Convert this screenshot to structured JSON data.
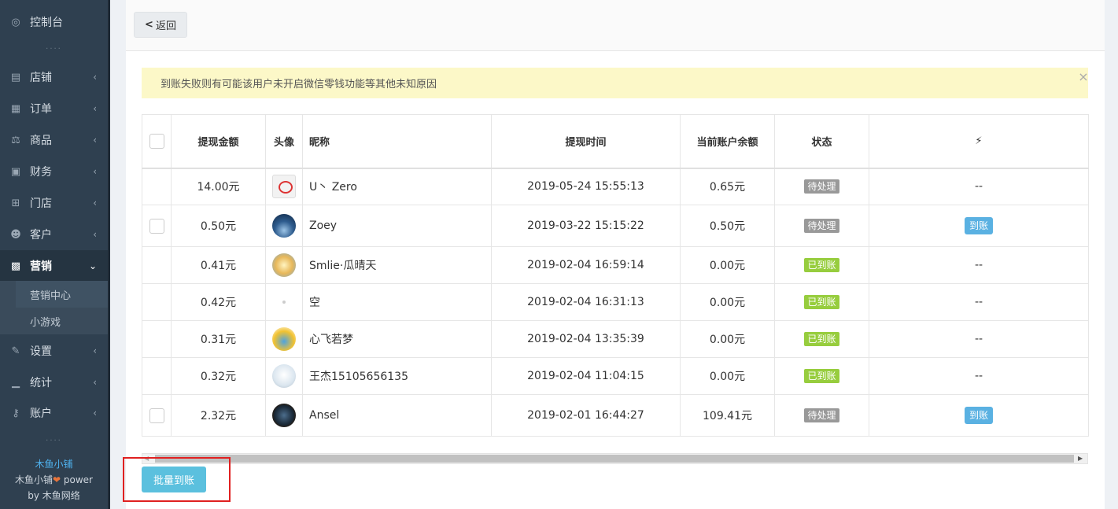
{
  "sidebar": {
    "items": [
      {
        "label": "控制台",
        "icon": "dashboard-icon"
      },
      {
        "label": "店铺",
        "icon": "shop-icon"
      },
      {
        "label": "订单",
        "icon": "order-icon"
      },
      {
        "label": "商品",
        "icon": "scale-icon"
      },
      {
        "label": "财务",
        "icon": "money-icon"
      },
      {
        "label": "门店",
        "icon": "sitemap-icon"
      },
      {
        "label": "客户",
        "icon": "users-icon"
      },
      {
        "label": "营销",
        "icon": "gift-icon"
      },
      {
        "label": "设置",
        "icon": "wrench-icon"
      },
      {
        "label": "统计",
        "icon": "bar-chart-icon"
      },
      {
        "label": "账户",
        "icon": "key-icon"
      }
    ],
    "submenu": [
      "营销中心",
      "小游戏"
    ],
    "dots": "....",
    "footer": {
      "shop_name": "木鱼小铺",
      "power_prefix": "木鱼小铺",
      "power_suffix": " power",
      "by": "by 木鱼网络"
    }
  },
  "topbar": {
    "back_label": "返回"
  },
  "alert": {
    "text": "到账失败则有可能该用户未开启微信零钱功能等其他未知原因",
    "close": "×"
  },
  "table": {
    "headers": {
      "amount": "提现金额",
      "avatar": "头像",
      "nickname": "昵称",
      "time": "提现时间",
      "balance": "当前账户余额",
      "status": "状态",
      "action": "⚡"
    },
    "rows": [
      {
        "amount": "14.00元",
        "nickname": "U丶 Zero",
        "time": "2019-05-24 15:55:13",
        "balance": "0.65元",
        "status": "待处理",
        "action": "--"
      },
      {
        "amount": "0.50元",
        "nickname": "Zoey",
        "time": "2019-03-22 15:15:22",
        "balance": "0.50元",
        "status": "待处理",
        "action": "到账"
      },
      {
        "amount": "0.41元",
        "nickname": "Smlie·瓜晴天",
        "time": "2019-02-04 16:59:14",
        "balance": "0.00元",
        "status": "已到账",
        "action": "--"
      },
      {
        "amount": "0.42元",
        "nickname": "空",
        "time": "2019-02-04 16:31:13",
        "balance": "0.00元",
        "status": "已到账",
        "action": "--"
      },
      {
        "amount": "0.31元",
        "nickname": "心飞若梦",
        "time": "2019-02-04 13:35:39",
        "balance": "0.00元",
        "status": "已到账",
        "action": "--"
      },
      {
        "amount": "0.32元",
        "nickname": "王杰15105656135",
        "time": "2019-02-04 11:04:15",
        "balance": "0.00元",
        "status": "已到账",
        "action": "--"
      },
      {
        "amount": "2.32元",
        "nickname": "Ansel",
        "time": "2019-02-01 16:44:27",
        "balance": "109.41元",
        "status": "待处理",
        "action": "到账"
      }
    ]
  },
  "batch_button": "批量到账"
}
